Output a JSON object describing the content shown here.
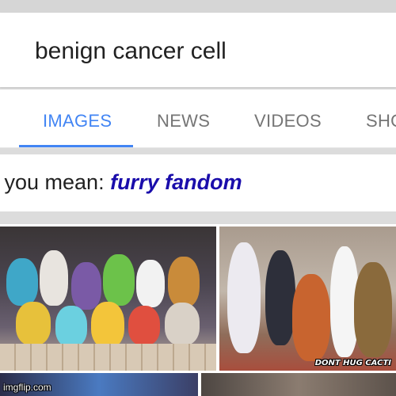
{
  "search": {
    "query": "benign cancer cell"
  },
  "tabs": [
    {
      "label": "IMAGES",
      "active": true
    },
    {
      "label": "NEWS",
      "active": false
    },
    {
      "label": "VIDEOS",
      "active": false
    },
    {
      "label": "SHO",
      "active": false
    }
  ],
  "suggestion": {
    "prefix": "l you mean: ",
    "link": "furry fandom"
  },
  "results": {
    "image_2_caption": "DONT HUG CACTI"
  },
  "watermark": {
    "text": "imgflip.com"
  },
  "colors": {
    "accent": "#4285f4",
    "suggest_link": "#1a0dab",
    "tab_inactive": "#757575"
  }
}
